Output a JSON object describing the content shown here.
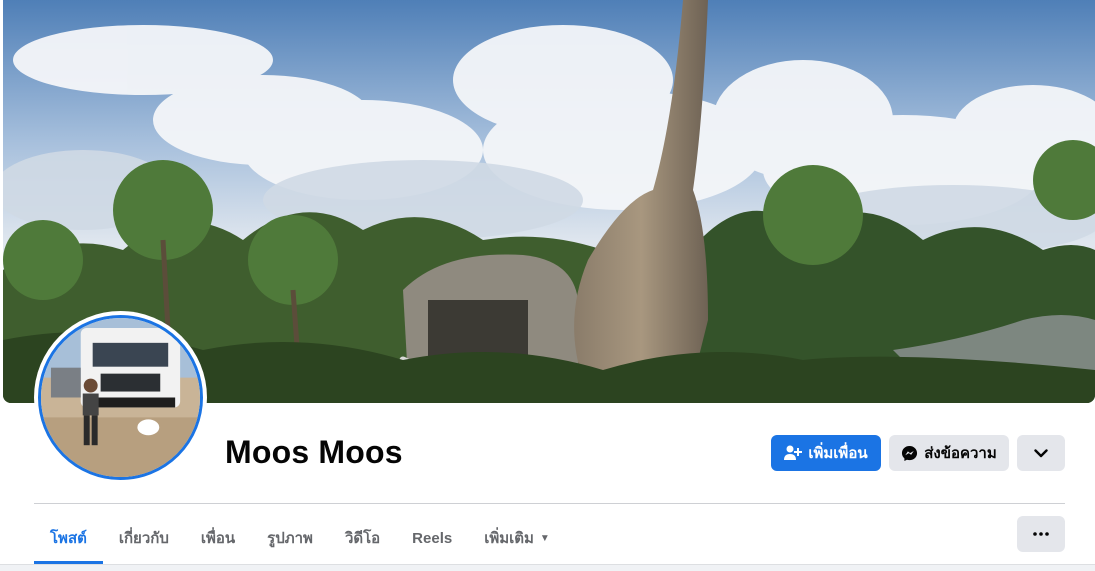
{
  "profile": {
    "name": "Moos Moos"
  },
  "actions": {
    "add_friend_label": "เพิ่มเพื่อน",
    "message_label": "ส่งข้อความ"
  },
  "tabs": [
    {
      "label": "โพสต์",
      "active": true
    },
    {
      "label": "เกี่ยวกับ",
      "active": false
    },
    {
      "label": "เพื่อน",
      "active": false
    },
    {
      "label": "รูปภาพ",
      "active": false
    },
    {
      "label": "วิดีโอ",
      "active": false
    },
    {
      "label": "Reels",
      "active": false
    },
    {
      "label": "เพิ่มเติม",
      "active": false
    }
  ],
  "icons": {
    "add_friend": "person-plus-icon",
    "message": "messenger-icon",
    "dropdown": "chevron-down-icon",
    "more": "more-horizontal-icon",
    "tab_more_caret": "caret-down-icon"
  },
  "colors": {
    "accent": "#1b74e4",
    "secondary_button": "#e4e6eb",
    "text_primary": "#050505",
    "text_secondary": "#65676b"
  }
}
